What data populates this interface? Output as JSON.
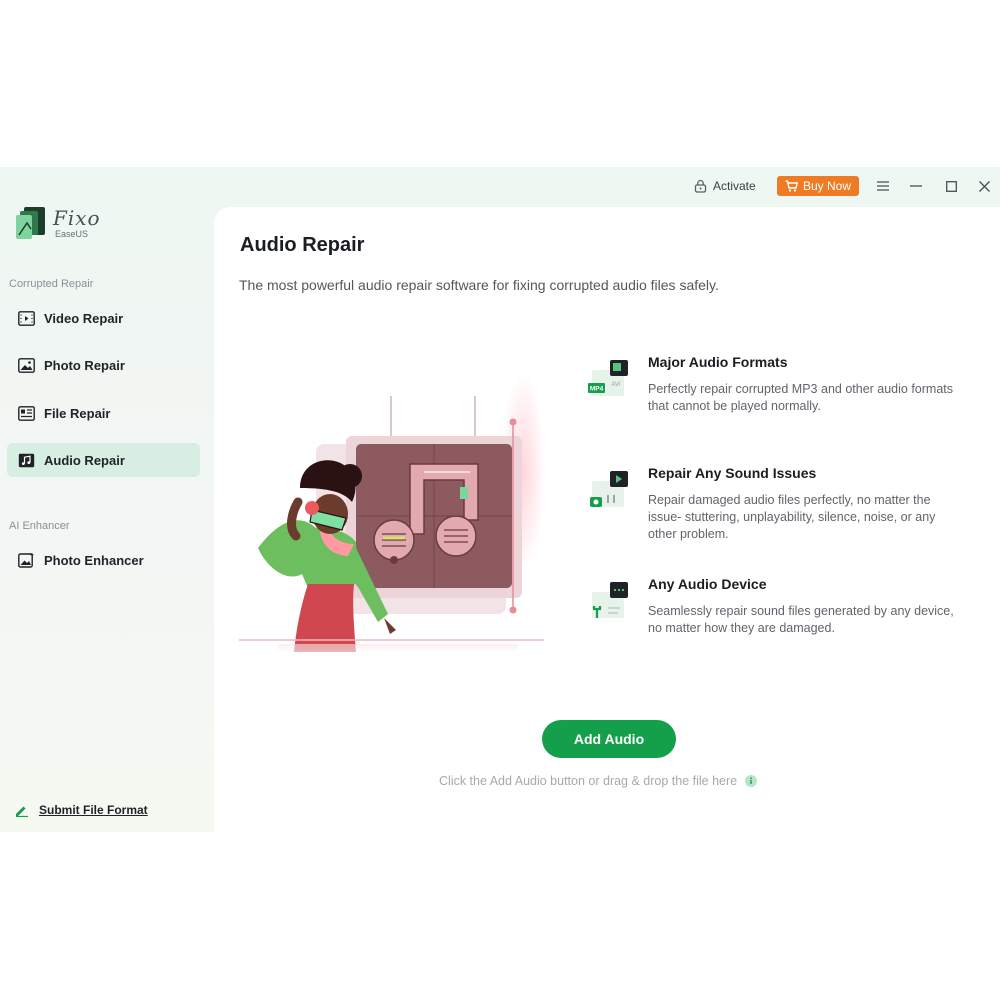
{
  "window": {
    "activate_label": "Activate",
    "buy_label": "Buy Now"
  },
  "brand": {
    "name": "Fixo",
    "sub": "EaseUS"
  },
  "sidebar": {
    "section_repair": "Corrupted Repair",
    "items": [
      {
        "label": "Video Repair",
        "icon": "video-icon"
      },
      {
        "label": "Photo Repair",
        "icon": "photo-icon"
      },
      {
        "label": "File Repair",
        "icon": "file-icon"
      },
      {
        "label": "Audio Repair",
        "icon": "audio-icon",
        "active": true
      }
    ],
    "section_ai": "AI Enhancer",
    "ai_items": [
      {
        "label": "Photo Enhancer",
        "icon": "photo-enhancer-icon"
      }
    ],
    "submit_label": "Submit File Format"
  },
  "main": {
    "title": "Audio Repair",
    "subtitle": "The most powerful audio repair software for fixing corrupted audio files safely.",
    "features": [
      {
        "title": "Major Audio Formats",
        "desc": "Perfectly repair corrupted MP3 and other audio formats that cannot be played normally.",
        "badge": "MP4",
        "badge2": "AVI"
      },
      {
        "title": "Repair Any Sound Issues",
        "desc": "Repair damaged audio files perfectly, no matter the issue- stuttering, unplayability, silence, noise, or any other problem."
      },
      {
        "title": "Any Audio Device",
        "desc": "Seamlessly repair sound files generated by any device, no matter how they are damaged."
      }
    ],
    "add_button": "Add Audio",
    "hint": "Click the Add Audio button or drag & drop the file here"
  },
  "colors": {
    "accent": "#14a04b",
    "buy": "#ef7b24",
    "active_nav": "#d7eee2"
  }
}
